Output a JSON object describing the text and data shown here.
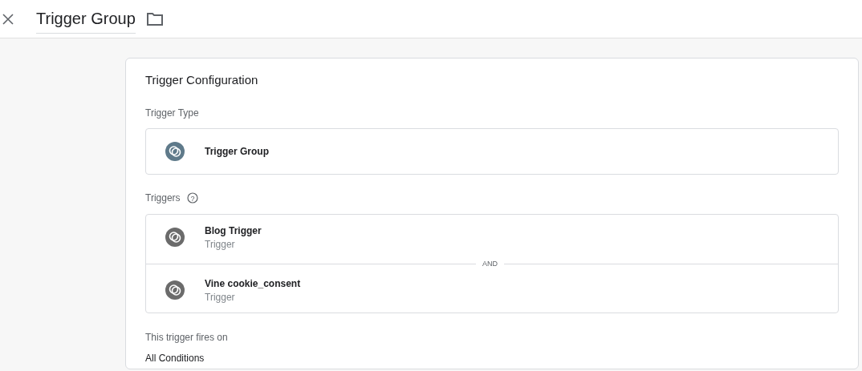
{
  "header": {
    "title": "Trigger Group"
  },
  "card": {
    "title": "Trigger Configuration",
    "trigger_type_label": "Trigger Type",
    "trigger_type": {
      "name": "Trigger Group"
    },
    "triggers_label": "Triggers",
    "help": "?",
    "triggers": [
      {
        "name": "Blog Trigger",
        "type": "Trigger"
      },
      {
        "name": "Vine cookie_consent",
        "type": "Trigger"
      }
    ],
    "separator": "AND",
    "fires_on_label": "This trigger fires on",
    "fires_on": "All Conditions"
  }
}
